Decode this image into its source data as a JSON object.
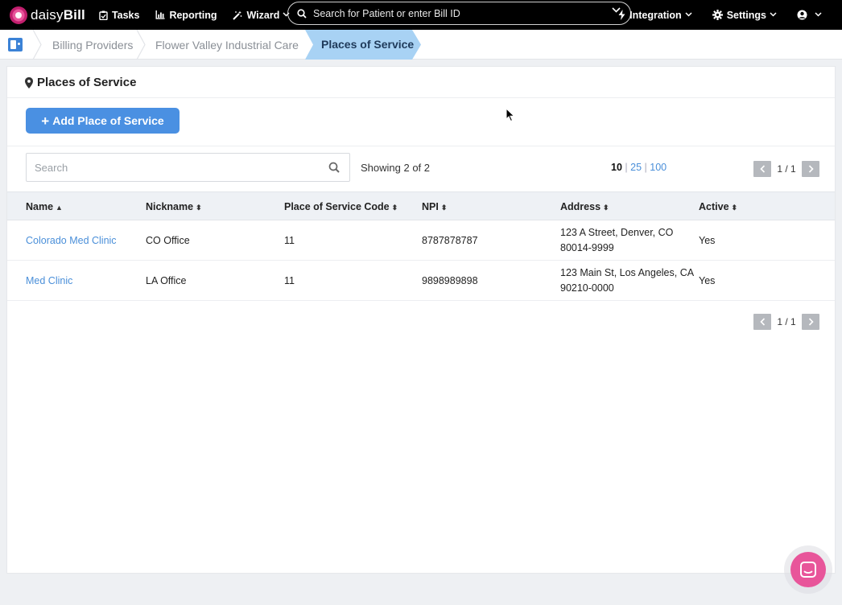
{
  "app": {
    "logo_text_light": "daisy",
    "logo_text_bold": "Bill"
  },
  "topnav": {
    "tasks": "Tasks",
    "reporting": "Reporting",
    "wizard": "Wizard",
    "search_placeholder": "Search for Patient or enter Bill ID",
    "integration": "Integration",
    "settings": "Settings"
  },
  "breadcrumb": {
    "items": [
      "Billing Providers",
      "Flower Valley Industrial Care"
    ],
    "active": "Places of Service"
  },
  "page": {
    "title": "Places of Service",
    "add_button": "Add Place of Service",
    "search_placeholder": "Search",
    "showing": "Showing 2 of 2",
    "page_sizes": {
      "current": "10",
      "options": [
        "25",
        "100"
      ]
    },
    "pager_text": "1 / 1"
  },
  "table": {
    "headers": [
      "Name",
      "Nickname",
      "Place of Service Code",
      "NPI",
      "Address",
      "Active"
    ],
    "rows": [
      {
        "name": "Colorado Med Clinic",
        "nickname": "CO Office",
        "code": "11",
        "npi": "8787878787",
        "address_line1": "123 A Street, Denver, CO",
        "address_line2": "80014-9999",
        "active": "Yes"
      },
      {
        "name": "Med Clinic",
        "nickname": "LA Office",
        "code": "11",
        "npi": "9898989898",
        "address_line1": "123 Main St, Los Angeles, CA",
        "address_line2": "90210-0000",
        "active": "Yes"
      }
    ]
  },
  "colors": {
    "accent": "#4a90e2",
    "link": "#4a8fd9",
    "chat": "#e8559a",
    "nav_bg": "#000000"
  }
}
